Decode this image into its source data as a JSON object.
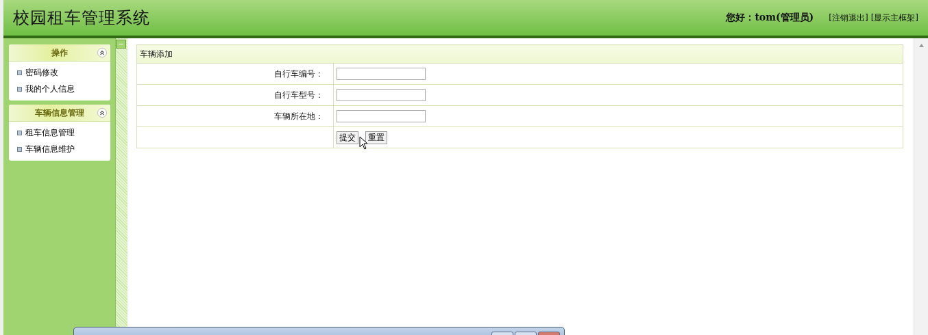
{
  "header": {
    "title": "校园租车管理系统",
    "greeting": "您好：tom(管理员)",
    "links": [
      "[注销退出]",
      "[显示主框架]"
    ]
  },
  "sidebar": {
    "sections": [
      {
        "title": "操作",
        "expanded": true,
        "items": [
          "密码修改",
          "我的个人信息"
        ]
      },
      {
        "title": "车辆信息管理",
        "expanded": true,
        "items": [
          "租车信息管理",
          "车辆信息维护"
        ]
      }
    ]
  },
  "form": {
    "title": "车辆添加",
    "fields": [
      {
        "label": "自行车编号："
      },
      {
        "label": "自行车型号："
      },
      {
        "label": "车辆所在地："
      }
    ],
    "buttons": [
      "提交",
      "重置"
    ]
  }
}
